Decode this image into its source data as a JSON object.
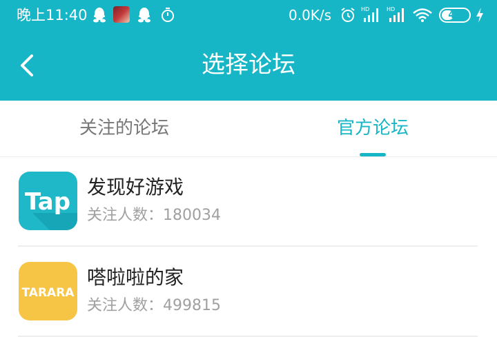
{
  "status_bar": {
    "time": "晚上11:40",
    "net_speed": "0.0K/s",
    "battery": "46",
    "battery_level": 0.46,
    "icons": [
      "qq-icon",
      "game-avatar-icon",
      "qq-icon",
      "timer-icon",
      "alarm-icon",
      "signal-icon",
      "signal-icon",
      "wifi-icon",
      "battery-icon",
      "charging-icon"
    ]
  },
  "header": {
    "title": "选择论坛",
    "back_icon": "chevron-left-icon",
    "bg_color": "#17b6c6"
  },
  "tabs": [
    {
      "label": "关注的论坛",
      "active": false
    },
    {
      "label": "官方论坛",
      "active": true
    }
  ],
  "forums": [
    {
      "name": "发现好游戏",
      "followers": "关注人数：180034",
      "logo_text": "Tap",
      "logo_color": "#1fb8c9"
    },
    {
      "name": "嗒啦啦的家",
      "followers": "关注人数：499815",
      "logo_text": "TARARA",
      "logo_color": "#f6c545"
    }
  ],
  "accent_color": "#17b6c6"
}
